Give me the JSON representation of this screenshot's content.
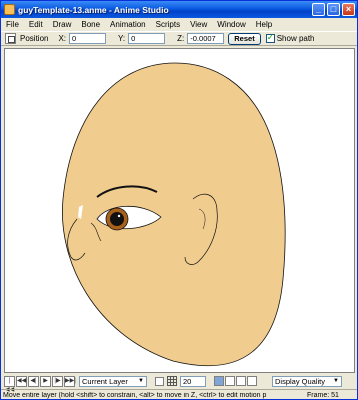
{
  "window": {
    "title": "guyTemplate-13.anme - Anime Studio",
    "minimize_glyph": "_",
    "maximize_glyph": "□",
    "close_glyph": "×"
  },
  "menu": [
    "File",
    "Edit",
    "Draw",
    "Bone",
    "Animation",
    "Scripts",
    "View",
    "Window",
    "Help"
  ],
  "toolbar": {
    "position_label": "Position",
    "x_label": "X:",
    "x_value": "0",
    "y_label": "Y:",
    "y_value": "0",
    "z_label": "Z:",
    "z_value": "-0.0007",
    "reset_label": "Reset",
    "show_path_label": "Show path",
    "show_path_checked": true
  },
  "canvas": {
    "background": "#ffffff",
    "face_fill": "#f1cc8f",
    "outline": "#111111",
    "iris_color": "#a8611a"
  },
  "playback": {
    "buttons": [
      "|◀◀",
      "◀◀",
      "◀|",
      "▶",
      "|▶",
      "▶▶|"
    ],
    "layer_select": "Current Layer",
    "frame_step": "20",
    "quality_select": "Display Quality"
  },
  "status": {
    "message": "Move entire layer (hold <shift> to constrain, <alt> to move in Z, <ctrl> to edit motion p",
    "frame_label": "Frame: 51"
  }
}
